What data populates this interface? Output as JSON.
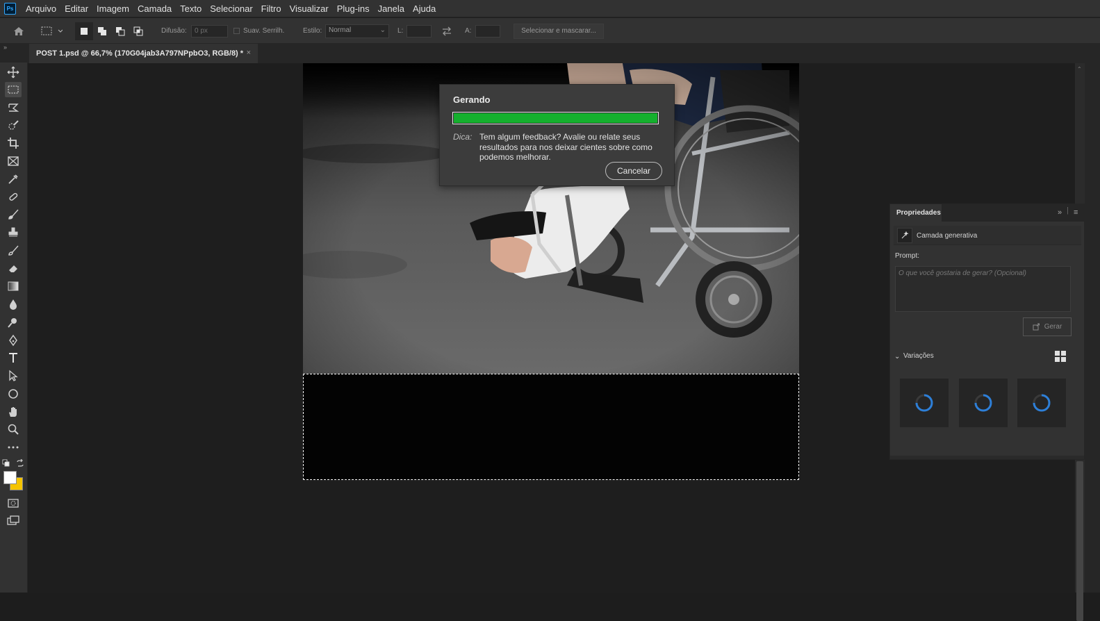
{
  "app": {
    "logo": "Ps",
    "menu": [
      "Arquivo",
      "Editar",
      "Imagem",
      "Camada",
      "Texto",
      "Selecionar",
      "Filtro",
      "Visualizar",
      "Plug-ins",
      "Janela",
      "Ajuda"
    ]
  },
  "options_bar": {
    "feather_label": "Difusão:",
    "feather_value": "0 px",
    "antialias_label": "Suav. Serrilh.",
    "style_label": "Estilo:",
    "style_value": "Normal",
    "width_label": "L:",
    "height_label": "A:",
    "select_mask_label": "Selecionar e mascarar..."
  },
  "document": {
    "tab_title": "POST 1.psd @ 66,7% (170G04jab3A797NPpbO3, RGB/8) *",
    "tab_close": "×"
  },
  "dialog": {
    "title": "Gerando",
    "progress": 1.0,
    "hint_label": "Dica:",
    "hint_text": "Tem algum feedback? Avalie ou relate seus resultados para nos deixar cientes sobre como podemos melhorar.",
    "cancel_label": "Cancelar"
  },
  "properties": {
    "tab": "Propriedades",
    "layer_type": "Camada generativa",
    "prompt_label": "Prompt:",
    "prompt_placeholder": "O que você gostaria de gerar?  (Opcional)",
    "generate_label": "Gerar",
    "variations_label": "Variações",
    "variations_count": 3
  },
  "colors": {
    "progress": "#15b02e",
    "foreground": "#ffffff",
    "background": "#f5c400",
    "spinner": "#2d7fd8"
  },
  "icons": [
    "home-icon",
    "marquee-icon",
    "move-icon",
    "lasso-icon",
    "quick-select-icon",
    "crop-icon",
    "frame-icon",
    "eyedropper-icon",
    "healing-icon",
    "brush-icon",
    "stamp-icon",
    "history-brush-icon",
    "eraser-icon",
    "gradient-icon",
    "blur-icon",
    "dodge-icon",
    "pen-icon",
    "type-icon",
    "path-select-icon",
    "ellipse-icon",
    "hand-icon",
    "zoom-icon",
    "more-icon",
    "quick-mask-icon",
    "screen-mode-icon"
  ]
}
